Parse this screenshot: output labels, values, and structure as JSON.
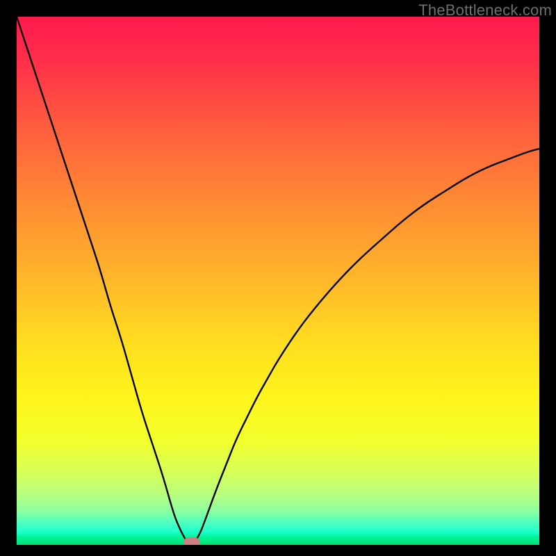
{
  "watermark": "TheBottleneck.com",
  "chart_data": {
    "type": "line",
    "title": "",
    "xlabel": "",
    "ylabel": "",
    "xlim": [
      0,
      100
    ],
    "ylim": [
      0,
      100
    ],
    "grid": false,
    "legend": false,
    "note": "V-shaped bottleneck curve; minimum (0) near x≈33; value≈100 at x=0 and ≈75 at x=100. No tick labels are shown.",
    "series": [
      {
        "name": "curve",
        "color": "#000000",
        "x": [
          0,
          2,
          4,
          6,
          8,
          10,
          12,
          14,
          16,
          18,
          20,
          22,
          24,
          26,
          28,
          30,
          31,
          32,
          33,
          34,
          35,
          36,
          38,
          40,
          42,
          44,
          46,
          48,
          50,
          54,
          58,
          62,
          66,
          70,
          74,
          78,
          82,
          86,
          90,
          94,
          98,
          100
        ],
        "y": [
          100,
          94,
          88,
          82,
          76,
          70,
          64,
          58,
          52,
          45,
          39,
          32,
          25,
          19,
          13,
          6,
          3.5,
          1.5,
          0,
          0.5,
          2,
          4.5,
          10,
          15,
          20,
          24,
          28,
          31.5,
          35,
          41,
          46,
          50.5,
          54.5,
          58,
          61.5,
          64.5,
          67,
          69.5,
          71.5,
          73,
          74.5,
          75
        ]
      }
    ],
    "marker": {
      "x": 33.5,
      "y": 0.6,
      "color": "#d08080",
      "rx": 1.6,
      "ry": 0.9
    },
    "background_gradient": {
      "stops": [
        {
          "offset": 0.0,
          "color": "#ff1a4d"
        },
        {
          "offset": 0.08,
          "color": "#ff2e4a"
        },
        {
          "offset": 0.2,
          "color": "#ff5a3f"
        },
        {
          "offset": 0.35,
          "color": "#ff8a34"
        },
        {
          "offset": 0.5,
          "color": "#ffb82a"
        },
        {
          "offset": 0.62,
          "color": "#ffde20"
        },
        {
          "offset": 0.72,
          "color": "#fff41c"
        },
        {
          "offset": 0.8,
          "color": "#f3ff2b"
        },
        {
          "offset": 0.86,
          "color": "#d8ff55"
        },
        {
          "offset": 0.905,
          "color": "#b8ff80"
        },
        {
          "offset": 0.935,
          "color": "#8effa0"
        },
        {
          "offset": 0.958,
          "color": "#4effc0"
        },
        {
          "offset": 0.975,
          "color": "#1effce"
        },
        {
          "offset": 0.985,
          "color": "#00f59a"
        },
        {
          "offset": 1.0,
          "color": "#00e070"
        }
      ]
    }
  }
}
